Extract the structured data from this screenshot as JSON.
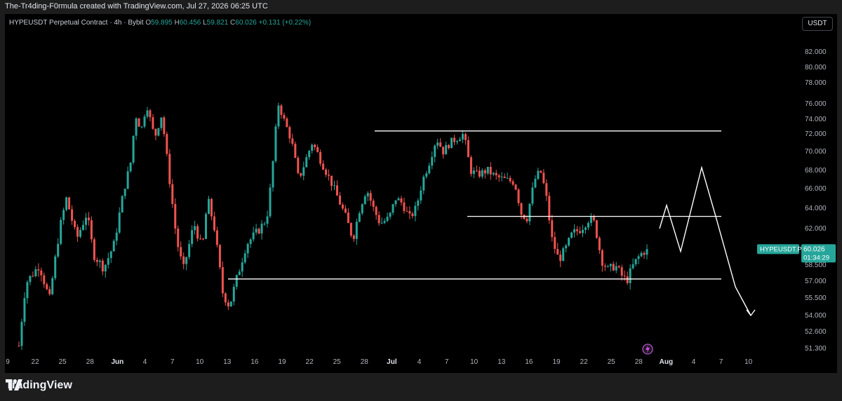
{
  "header": {
    "credit": "The-Tr4ding-F0rmula created with TradingView.com, Jul 27, 2026 06:25 UTC"
  },
  "legend": {
    "symbol": "HYPEUSDT Perpetual Contract · 4h · Bybit",
    "o_label": "O",
    "o": "59.895",
    "h_label": "H",
    "h": "60.456",
    "l_label": "L",
    "l": "59.821",
    "c_label": "C",
    "c": "60.026",
    "change": "+0.131 (+0.22%)"
  },
  "currency_button": "USDT",
  "price_tag": {
    "symbol": "HYPEUSDT.P",
    "price": "60.026",
    "countdown": "01:34:29"
  },
  "colors": {
    "up": "#26a69a",
    "down": "#ef5350",
    "line": "#ffffff",
    "background": "#000000"
  },
  "chart_data": {
    "type": "candlestick",
    "timeframe": "4h",
    "y_axis_ticks": [
      "82.000",
      "80.000",
      "78.000",
      "76.000",
      "74.000",
      "72.000",
      "70.000",
      "68.000",
      "66.000",
      "64.000",
      "62.000",
      "58.500",
      "57.000",
      "55.500",
      "54.000",
      "52.600",
      "51.300"
    ],
    "x_axis_ticks": [
      "9",
      "22",
      "25",
      "28",
      "Jun",
      "4",
      "7",
      "10",
      "13",
      "16",
      "19",
      "22",
      "25",
      "28",
      "Jul",
      "4",
      "7",
      "10",
      "13",
      "16",
      "19",
      "22",
      "25",
      "28",
      "Aug",
      "4",
      "7",
      "10"
    ],
    "path_points": [
      [
        0,
        51.5
      ],
      [
        10,
        56.8
      ],
      [
        30,
        58.5
      ],
      [
        45,
        55.3
      ],
      [
        60,
        62
      ],
      [
        70,
        65
      ],
      [
        85,
        61
      ],
      [
        100,
        63.5
      ],
      [
        110,
        59.5
      ],
      [
        125,
        58.2
      ],
      [
        140,
        60.5
      ],
      [
        155,
        66
      ],
      [
        165,
        69
      ],
      [
        172,
        74.5
      ],
      [
        180,
        72.5
      ],
      [
        188,
        76
      ],
      [
        200,
        71.5
      ],
      [
        210,
        74.5
      ],
      [
        220,
        68
      ],
      [
        232,
        61
      ],
      [
        242,
        58
      ],
      [
        258,
        62.5
      ],
      [
        270,
        60
      ],
      [
        278,
        65
      ],
      [
        288,
        62
      ],
      [
        300,
        56
      ],
      [
        310,
        54.8
      ],
      [
        322,
        57.5
      ],
      [
        335,
        60.5
      ],
      [
        355,
        62
      ],
      [
        365,
        63
      ],
      [
        372,
        67
      ],
      [
        382,
        76
      ],
      [
        390,
        74
      ],
      [
        402,
        71
      ],
      [
        412,
        67
      ],
      [
        422,
        69
      ],
      [
        432,
        71
      ],
      [
        445,
        69
      ],
      [
        458,
        67
      ],
      [
        470,
        65
      ],
      [
        482,
        63
      ],
      [
        492,
        61
      ],
      [
        502,
        64
      ],
      [
        512,
        66
      ],
      [
        522,
        64
      ],
      [
        532,
        62.5
      ],
      [
        545,
        63
      ],
      [
        555,
        65
      ],
      [
        565,
        64.5
      ],
      [
        575,
        63
      ],
      [
        585,
        64
      ],
      [
        595,
        67
      ],
      [
        605,
        69
      ],
      [
        615,
        71.5
      ],
      [
        625,
        70
      ],
      [
        635,
        71
      ],
      [
        645,
        71.5
      ],
      [
        655,
        72
      ],
      [
        665,
        68
      ],
      [
        675,
        67.5
      ],
      [
        690,
        68
      ],
      [
        702,
        67.3
      ],
      [
        715,
        67
      ],
      [
        730,
        66.7
      ],
      [
        740,
        63.5
      ],
      [
        748,
        63
      ],
      [
        760,
        67
      ],
      [
        768,
        68
      ],
      [
        776,
        65.5
      ],
      [
        785,
        61
      ],
      [
        795,
        59
      ],
      [
        805,
        60
      ],
      [
        815,
        61.5
      ],
      [
        828,
        62
      ],
      [
        840,
        63
      ],
      [
        848,
        62.5
      ],
      [
        858,
        59
      ],
      [
        868,
        58
      ],
      [
        878,
        58.5
      ],
      [
        888,
        57.5
      ],
      [
        895,
        57
      ],
      [
        905,
        58.5
      ],
      [
        915,
        59.5
      ],
      [
        925,
        60.026
      ]
    ],
    "drawn_levels": [
      72.4,
      63.2,
      57.2
    ],
    "projection_path": [
      [
        62.0,
        0
      ],
      [
        64.3,
        10
      ],
      [
        59.8,
        30
      ],
      [
        68.3,
        60
      ],
      [
        63.2,
        80
      ],
      [
        56.5,
        108
      ],
      [
        54.0,
        130
      ]
    ]
  }
}
